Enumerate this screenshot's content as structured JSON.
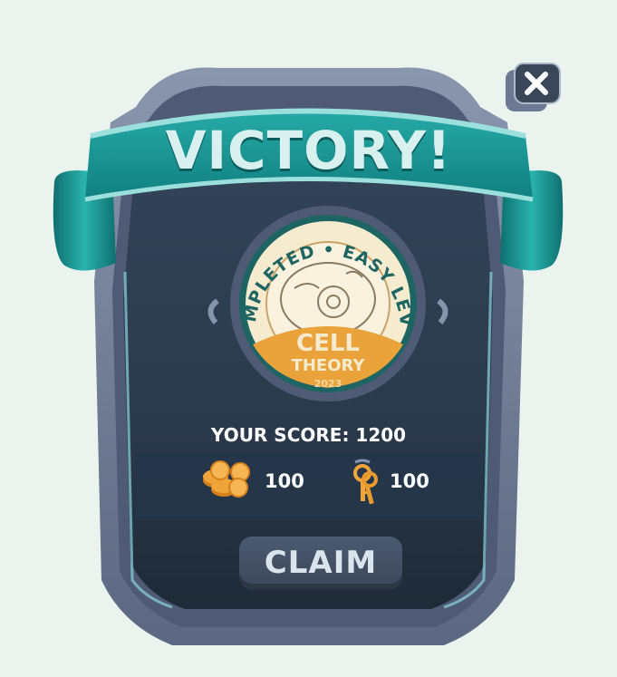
{
  "title": "VICTORY!",
  "badge": {
    "top_text": "COMPLETED • EASY LEVEL",
    "line1": "CELL",
    "line2": "THEORY",
    "year": "2023"
  },
  "score_text": "YOUR SCORE: 1200",
  "rewards": [
    {
      "icon": "coins-icon",
      "value": "100"
    },
    {
      "icon": "keys-icon",
      "value": "100"
    }
  ],
  "claim_label": "CLAIM",
  "colors": {
    "background": "#eaf3ee",
    "panel": "#2c3b4c",
    "frame": "#6d7994",
    "ribbon": "#1b9a98",
    "badge_orange": "#e9a33a",
    "badge_cream": "#f5ecd0"
  }
}
